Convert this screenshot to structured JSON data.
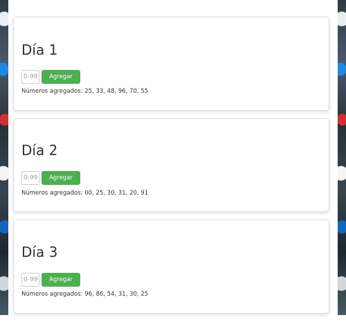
{
  "input": {
    "placeholder": "0-99"
  },
  "days": [
    {
      "title": "Día 1",
      "button_label": "Agregar",
      "numbers_prefix": "Números agregados:",
      "numbers": "25, 33, 48, 96, 70, 55"
    },
    {
      "title": "Día 2",
      "button_label": "Agregar",
      "numbers_prefix": "Números agregados:",
      "numbers": "00, 25, 30, 31, 20, 91"
    },
    {
      "title": "Día 3",
      "button_label": "Agregar",
      "numbers_prefix": "Números agregados:",
      "numbers": "96, 86, 54, 31, 30, 25"
    }
  ],
  "colors": {
    "button": "#4caf50",
    "text": "#333333",
    "border": "#dcdcdc"
  }
}
